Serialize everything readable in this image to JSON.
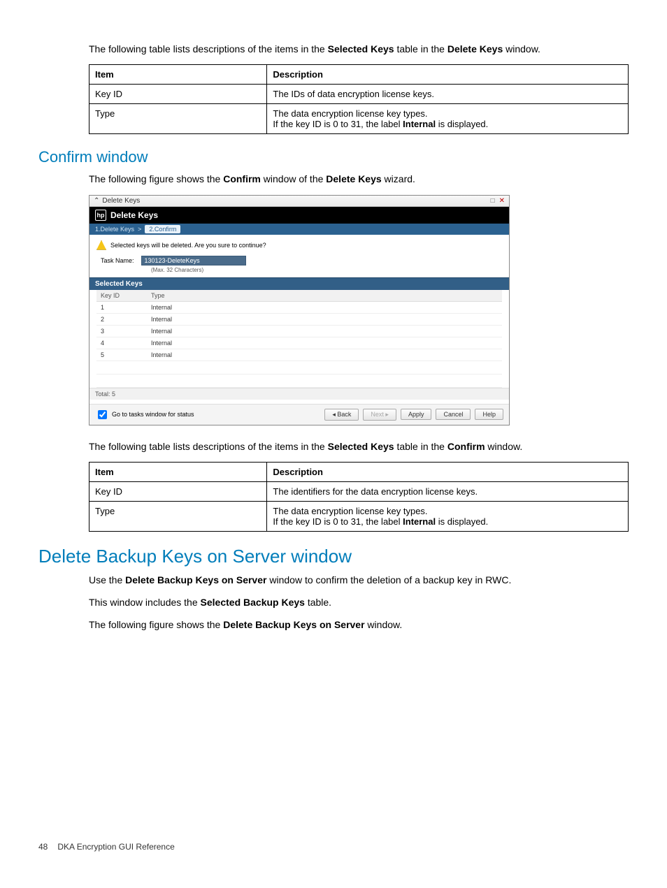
{
  "intro1_a": "The following table lists descriptions of the items in the ",
  "intro1_b": "Selected Keys",
  "intro1_c": " table in the ",
  "intro1_d": "Delete Keys",
  "intro1_e": " window.",
  "table1": {
    "h1": "Item",
    "h2": "Description",
    "r1c1": "Key ID",
    "r1c2": "The IDs of data encryption license keys.",
    "r2c1": "Type",
    "r2c2a": "The data encryption license key types.",
    "r2c2b_a": "If the key ID is 0 to 31, the label ",
    "r2c2b_b": "Internal",
    "r2c2b_c": " is displayed."
  },
  "sectionA": "Confirm window",
  "paraA_a": "The following figure shows the ",
  "paraA_b": "Confirm",
  "paraA_c": " window of the ",
  "paraA_d": "Delete Keys",
  "paraA_e": " wizard.",
  "dialog": {
    "outerTitle": "Delete Keys",
    "innerTitle": "Delete Keys",
    "bc1": "1.Delete Keys",
    "bcsep": ">",
    "bc2": "2.Confirm",
    "warn": "Selected keys will be deleted. Are you sure to continue?",
    "fieldLabel": "Task Name:",
    "fieldValue": "130123-DeleteKeys",
    "hint": "(Max. 32 Characters)",
    "selHeader": "Selected Keys",
    "colA": "Key ID",
    "colB": "Type",
    "rows": [
      {
        "id": "1",
        "type": "Internal"
      },
      {
        "id": "2",
        "type": "Internal"
      },
      {
        "id": "3",
        "type": "Internal"
      },
      {
        "id": "4",
        "type": "Internal"
      },
      {
        "id": "5",
        "type": "Internal"
      }
    ],
    "total": "Total: 5",
    "chk": "Go to tasks window for status",
    "back": "Back",
    "next": "Next",
    "apply": "Apply",
    "cancel": "Cancel",
    "help": "Help"
  },
  "intro2_a": "The following table lists descriptions of the items in the ",
  "intro2_b": "Selected Keys",
  "intro2_c": " table in the ",
  "intro2_d": "Confirm",
  "intro2_e": " window.",
  "table2": {
    "h1": "Item",
    "h2": "Description",
    "r1c1": "Key ID",
    "r1c2": "The identifiers for the data encryption license keys.",
    "r2c1": "Type",
    "r2c2a": "The data encryption license key types.",
    "r2c2b_a": "If the key ID is 0 to 31, the label ",
    "r2c2b_b": "Internal",
    "r2c2b_c": " is displayed."
  },
  "sectionB": "Delete Backup Keys on Server window",
  "paraB1_a": "Use the ",
  "paraB1_b": "Delete Backup Keys on Server",
  "paraB1_c": " window to confirm the deletion of a backup key in RWC.",
  "paraB2_a": "This window includes the ",
  "paraB2_b": "Selected Backup Keys",
  "paraB2_c": " table.",
  "paraB3_a": "The following figure shows the ",
  "paraB3_b": "Delete Backup Keys on Server",
  "paraB3_c": " window.",
  "footer": {
    "page": "48",
    "title": "DKA Encryption GUI Reference"
  }
}
